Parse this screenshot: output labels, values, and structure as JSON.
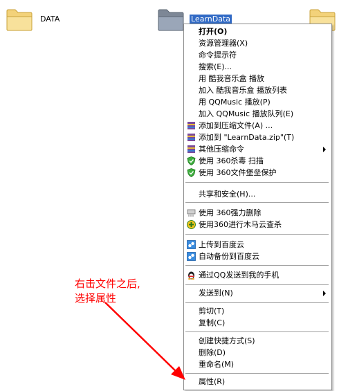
{
  "desktop": {
    "items": [
      {
        "label": "DATA"
      },
      {
        "label": "LearnData"
      },
      {
        "label": ""
      }
    ]
  },
  "menu": {
    "items": [
      {
        "label": "打开(O)"
      },
      {
        "label": "资源管理器(X)"
      },
      {
        "label": "命令提示符"
      },
      {
        "label": "搜索(E)..."
      },
      {
        "label": "用 酷我音乐盒 播放"
      },
      {
        "label": "加入 酷我音乐盒 播放列表"
      },
      {
        "label": "用 QQMusic 播放(P)"
      },
      {
        "label": "加入 QQMusic 播放队列(E)"
      },
      {
        "label": "添加到压缩文件(A) ..."
      },
      {
        "label": "添加到 \"LearnData.zip\"(T)"
      },
      {
        "label": "其他压缩命令"
      },
      {
        "label": "使用 360杀毒 扫描"
      },
      {
        "label": "使用 360文件堡垒保护"
      },
      {
        "label": "共享和安全(H)..."
      },
      {
        "label": "使用 360强力删除"
      },
      {
        "label": "使用360进行木马云查杀"
      },
      {
        "label": "上传到百度云"
      },
      {
        "label": "自动备份到百度云"
      },
      {
        "label": "通过QQ发送到我的手机"
      },
      {
        "label": "发送到(N)"
      },
      {
        "label": "剪切(T)"
      },
      {
        "label": "复制(C)"
      },
      {
        "label": "创建快捷方式(S)"
      },
      {
        "label": "删除(D)"
      },
      {
        "label": "重命名(M)"
      },
      {
        "label": "属性(R)"
      }
    ]
  },
  "annotation": {
    "line1": "右击文件之后,",
    "line2": "选择属性",
    "color": "#ff0000"
  },
  "icons": {
    "folder": "folder-icon",
    "archive": "archive-icon",
    "shield": "shield-icon",
    "shredder": "shredder-icon",
    "trojan": "trojan-scan-icon",
    "cloud": "baidu-cloud-icon",
    "qq": "qq-penguin-icon",
    "arrow": "red-arrow"
  }
}
